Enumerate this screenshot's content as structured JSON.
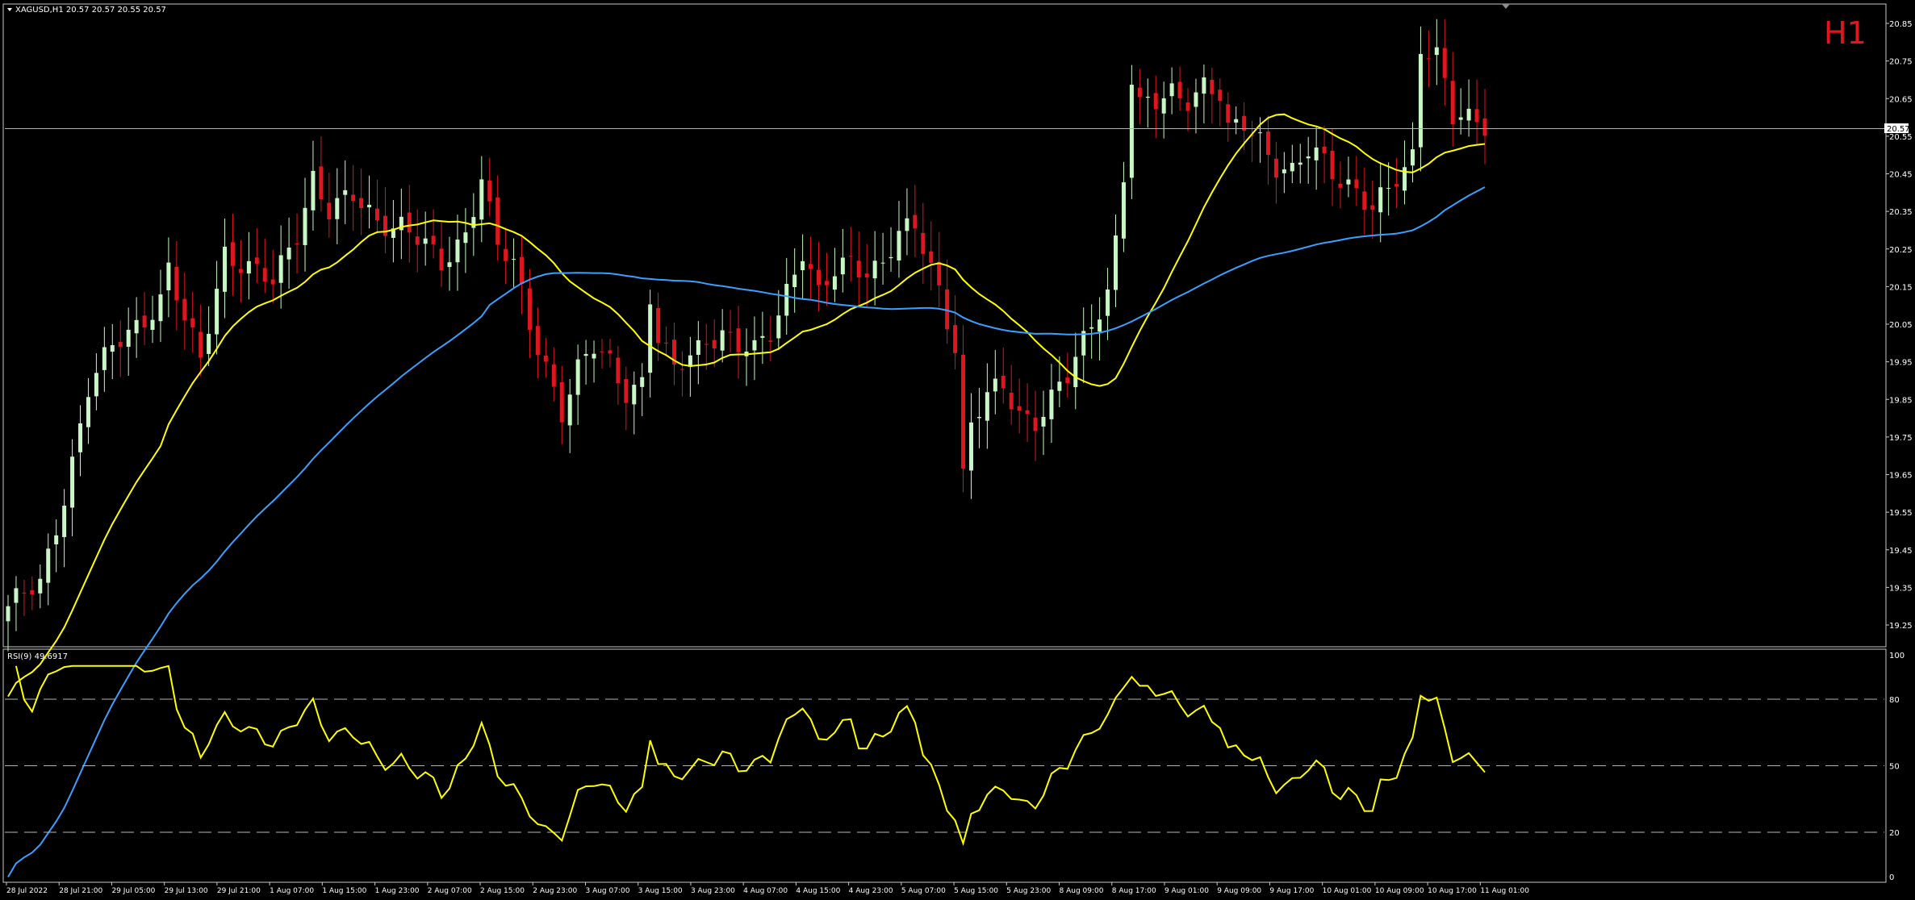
{
  "app": {
    "symbol_header": "XAGUSD,H1  20.57 20.57 20.55 20.57",
    "timeframe_badge": "H1",
    "rsi_header": "RSI(9) 49.6917",
    "current_price_label": "20.57",
    "colors": {
      "background": "#000000",
      "bull_candle": "#c8f7c5",
      "bear_candle": "#e0151e",
      "ma_fast": "#ffff00",
      "ma_slow": "#3aa0ff",
      "rsi_line": "#ffff00",
      "badge": "#e0151e",
      "axis_text": "#ffffff"
    }
  },
  "chart_data": [
    {
      "type": "candlestick",
      "title": "XAGUSD,H1",
      "y_ticks": [
        "20.85",
        "20.75",
        "20.65",
        "20.55",
        "20.45",
        "20.35",
        "20.25",
        "20.15",
        "20.05",
        "19.95",
        "19.85",
        "19.75",
        "19.65",
        "19.55",
        "19.45",
        "19.35",
        "19.25"
      ],
      "ylim": [
        19.2,
        20.9
      ],
      "x_ticks": [
        "28 Jul 2022",
        "28 Jul 21:00",
        "29 Jul 05:00",
        "29 Jul 13:00",
        "29 Jul 21:00",
        "1 Aug 07:00",
        "1 Aug 15:00",
        "1 Aug 23:00",
        "2 Aug 07:00",
        "2 Aug 15:00",
        "2 Aug 23:00",
        "3 Aug 07:00",
        "3 Aug 15:00",
        "3 Aug 23:00",
        "4 Aug 07:00",
        "4 Aug 15:00",
        "4 Aug 23:00",
        "5 Aug 07:00",
        "5 Aug 15:00",
        "5 Aug 23:00",
        "8 Aug 09:00",
        "8 Aug 17:00",
        "9 Aug 01:00",
        "9 Aug 09:00",
        "9 Aug 17:00",
        "10 Aug 01:00",
        "10 Aug 09:00",
        "10 Aug 17:00",
        "11 Aug 01:00"
      ],
      "current_price": 20.57,
      "close_anchors": [
        [
          0,
          19.3
        ],
        [
          4,
          19.35
        ],
        [
          7,
          19.6
        ],
        [
          10,
          19.88
        ],
        [
          13,
          19.98
        ],
        [
          16,
          20.05
        ],
        [
          19,
          20.12
        ],
        [
          20,
          20.2
        ],
        [
          22,
          20.05
        ],
        [
          24,
          19.95
        ],
        [
          27,
          20.25
        ],
        [
          30,
          20.2
        ],
        [
          33,
          20.15
        ],
        [
          36,
          20.3
        ],
        [
          38,
          20.45
        ],
        [
          40,
          20.35
        ],
        [
          43,
          20.38
        ],
        [
          46,
          20.33
        ],
        [
          49,
          20.32
        ],
        [
          52,
          20.25
        ],
        [
          54,
          20.2
        ],
        [
          57,
          20.3
        ],
        [
          59,
          20.45
        ],
        [
          61,
          20.25
        ],
        [
          63,
          20.2
        ],
        [
          65,
          20.05
        ],
        [
          67,
          19.95
        ],
        [
          69,
          19.82
        ],
        [
          71,
          19.92
        ],
        [
          73,
          19.98
        ],
        [
          75,
          19.95
        ],
        [
          77,
          19.88
        ],
        [
          79,
          19.9
        ],
        [
          80,
          20.12
        ],
        [
          81,
          20.0
        ],
        [
          83,
          19.92
        ],
        [
          85,
          19.97
        ],
        [
          87,
          20.02
        ],
        [
          89,
          20.03
        ],
        [
          91,
          19.98
        ],
        [
          93,
          19.97
        ],
        [
          95,
          20.03
        ],
        [
          97,
          20.15
        ],
        [
          99,
          20.25
        ],
        [
          101,
          20.12
        ],
        [
          103,
          20.18
        ],
        [
          105,
          20.22
        ],
        [
          107,
          20.2
        ],
        [
          109,
          20.22
        ],
        [
          111,
          20.28
        ],
        [
          113,
          20.3
        ],
        [
          115,
          20.2
        ],
        [
          116,
          20.15
        ],
        [
          118,
          20.0
        ],
        [
          119,
          19.65
        ],
        [
          120,
          19.78
        ],
        [
          122,
          19.85
        ],
        [
          124,
          19.88
        ],
        [
          126,
          19.82
        ],
        [
          128,
          19.8
        ],
        [
          130,
          19.85
        ],
        [
          132,
          19.9
        ],
        [
          134,
          20.0
        ],
        [
          136,
          20.1
        ],
        [
          137,
          20.15
        ],
        [
          138,
          20.28
        ],
        [
          139,
          20.45
        ],
        [
          140,
          20.7
        ],
        [
          141,
          20.62
        ],
        [
          143,
          20.63
        ],
        [
          145,
          20.67
        ],
        [
          147,
          20.66
        ],
        [
          149,
          20.69
        ],
        [
          151,
          20.65
        ],
        [
          152,
          20.55
        ],
        [
          154,
          20.58
        ],
        [
          156,
          20.55
        ],
        [
          158,
          20.48
        ],
        [
          160,
          20.45
        ],
        [
          162,
          20.5
        ],
        [
          164,
          20.48
        ],
        [
          166,
          20.44
        ],
        [
          168,
          20.42
        ],
        [
          170,
          20.35
        ],
        [
          172,
          20.4
        ],
        [
          174,
          20.45
        ],
        [
          175,
          20.5
        ],
        [
          176,
          20.8
        ],
        [
          178,
          20.78
        ],
        [
          179,
          20.7
        ],
        [
          180,
          20.6
        ],
        [
          182,
          20.58
        ],
        [
          184,
          20.57
        ]
      ],
      "candle_count": 185,
      "series": [
        {
          "name": "",
          "kind": "moving_average",
          "period": 20,
          "color": "#ffff00"
        },
        {
          "name": "",
          "kind": "moving_average",
          "period": 60,
          "color": "#3aa0ff"
        }
      ]
    },
    {
      "type": "line",
      "title": "RSI(9) 49.6917",
      "y_ticks": [
        "100",
        "80",
        "50",
        "20",
        "0"
      ],
      "ylim": [
        0,
        100
      ],
      "levels": [
        80,
        50,
        20
      ],
      "last_value": 49.6917
    }
  ]
}
